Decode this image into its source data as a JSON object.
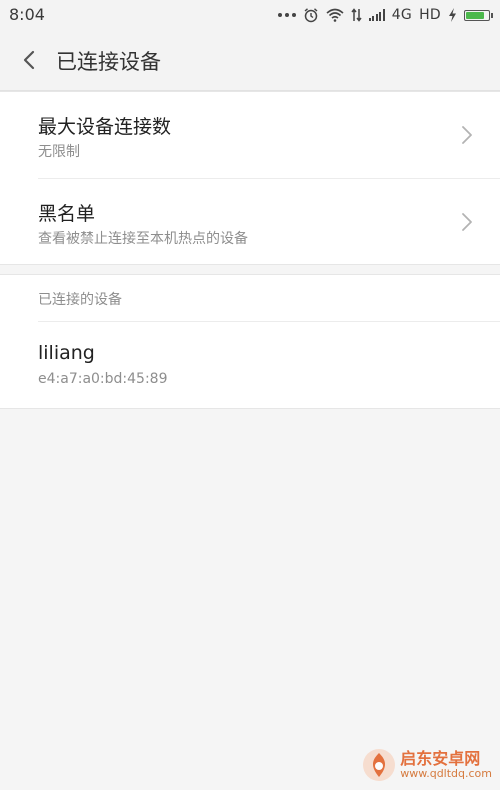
{
  "status_bar": {
    "time": "8:04",
    "network": "4G",
    "hd": "HD",
    "battery_level": 0.85,
    "battery_color": "#4cb84c"
  },
  "header": {
    "title": "已连接设备",
    "back_icon": "chevron-left-icon"
  },
  "settings": [
    {
      "title": "最大设备连接数",
      "subtitle": "无限制",
      "icon": "chevron-right-icon"
    },
    {
      "title": "黑名单",
      "subtitle": "查看被禁止连接至本机热点的设备",
      "icon": "chevron-right-icon"
    }
  ],
  "connected_section": {
    "header": "已连接的设备",
    "devices": [
      {
        "name": "liliang",
        "mac": "e4:a7:a0:bd:45:89"
      }
    ]
  },
  "watermark": {
    "name": "启东安卓网",
    "url": "www.qdltdq.com"
  },
  "colors": {
    "background": "#f5f5f5",
    "card": "#ffffff",
    "primary_text": "#222222",
    "secondary_text": "#8e8e8e",
    "watermark_accent": "#e05a1f"
  }
}
